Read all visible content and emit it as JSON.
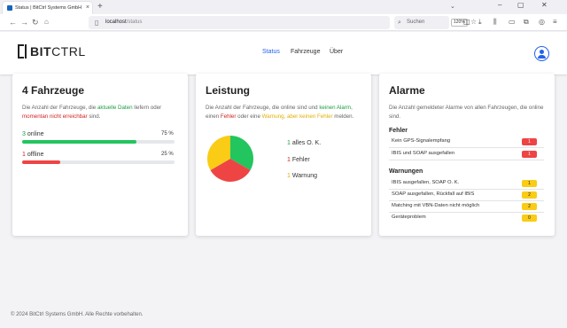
{
  "browser": {
    "tab_title": "Status | BitCtrl Systems GmbH",
    "tab_close": "×",
    "new_tab": "+",
    "tab_list": "⌄",
    "url_host": "localhost",
    "url_path": "/status",
    "zoom": "120%",
    "search_placeholder": "Suchen"
  },
  "header": {
    "logo_bold": "BIT",
    "logo_light": "CTRL",
    "menu": [
      {
        "label": "Status"
      },
      {
        "label": "Fahrzeuge"
      },
      {
        "label": "Über"
      }
    ]
  },
  "vehicles": {
    "title": "4 Fahrzeuge",
    "desc_1": "Die Anzahl der Fahrzeuge, die ",
    "desc_green": "aktuelle Daten",
    "desc_2": " liefern oder ",
    "desc_red": "momentan nicht erreichbar",
    "desc_3": " sind.",
    "online_count": "3",
    "online_label": " online",
    "online_pct": "75 %",
    "online_fraction": 0.75,
    "offline_count": "1",
    "offline_label": " offline",
    "offline_pct": "25 %",
    "offline_fraction": 0.25
  },
  "performance": {
    "title": "Leistung",
    "desc_1": "Die Anzahl der Fahrzeuge, die online sind und ",
    "desc_green": "keinen Alarm",
    "desc_2": ", einen ",
    "desc_red": "Fehler",
    "desc_3": " oder eine ",
    "desc_yellow": "Warnung, aber keinen Fehler",
    "desc_4": " melden.",
    "legend": [
      {
        "count": "1",
        "label": " alles O. K.",
        "color": "#22c55e"
      },
      {
        "count": "1",
        "label": " Fehler",
        "color": "#ef4444"
      },
      {
        "count": "1",
        "label": " Warnung",
        "color": "#facc15"
      }
    ]
  },
  "alarms": {
    "title": "Alarme",
    "desc": "Die Anzahl gemeldeter Alarme von allen Fahrzeugen, die online sind.",
    "errors_heading": "Fehler",
    "errors": [
      {
        "text": "Kein GPS-Signalempfang",
        "count": "1"
      },
      {
        "text": "IBIS und SOAP ausgefallen",
        "count": "1"
      }
    ],
    "warnings_heading": "Warnungen",
    "warnings": [
      {
        "text": "IBIS ausgefallen, SOAP O. K.",
        "count": "1"
      },
      {
        "text": "SOAP ausgefallen, Rückfall auf IBIS",
        "count": "2"
      },
      {
        "text": "Matching mit VBN-Daten nicht möglich",
        "count": "2"
      },
      {
        "text": "Geräteproblem",
        "count": "0"
      }
    ]
  },
  "footer": "© 2024 BitCtrl Systems GmbH. Alle Rechte vorbehalten."
}
